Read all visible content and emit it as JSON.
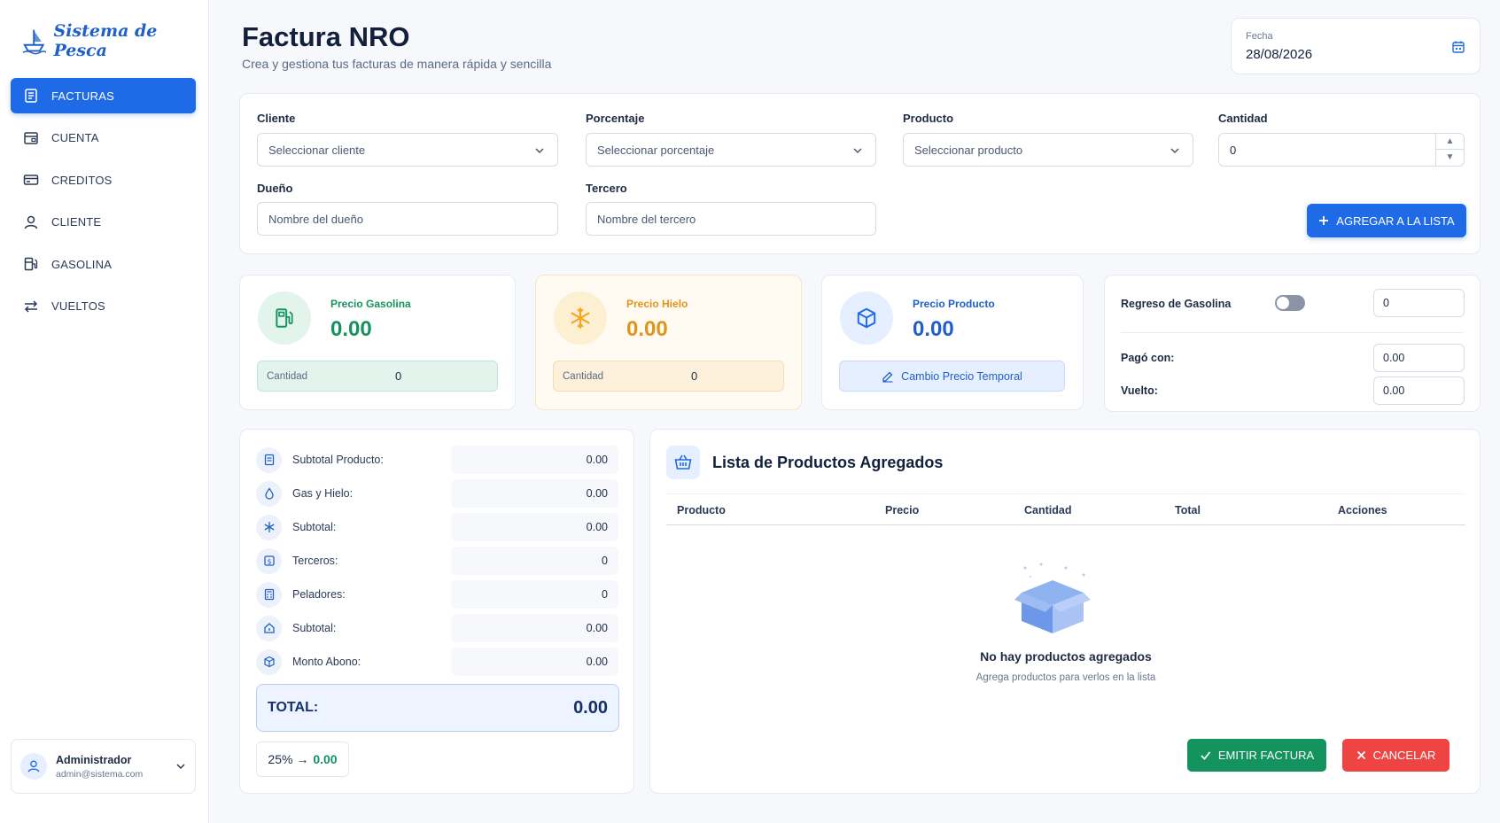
{
  "app": {
    "name": "Sistema de Pesca"
  },
  "sidebar": {
    "items": [
      {
        "label": "FACTURAS",
        "icon": "invoice-icon"
      },
      {
        "label": "CUENTA",
        "icon": "account-icon"
      },
      {
        "label": "CREDITOS",
        "icon": "credit-card-icon"
      },
      {
        "label": "CLIENTE",
        "icon": "user-icon"
      },
      {
        "label": "GASOLINA",
        "icon": "gas-station-icon"
      },
      {
        "label": "VUELTOS",
        "icon": "exchange-icon"
      }
    ],
    "active_index": 0
  },
  "user": {
    "name": "Administrador",
    "email": "admin@sistema.com"
  },
  "header": {
    "title": "Factura NRO",
    "subtitle": "Crea y gestiona tus facturas de manera rápida y sencilla",
    "date_label": "Fecha",
    "date_value": "28/08/2026"
  },
  "form": {
    "cliente": {
      "label": "Cliente",
      "placeholder": "Seleccionar cliente"
    },
    "porcentaje": {
      "label": "Porcentaje",
      "placeholder": "Seleccionar porcentaje"
    },
    "producto": {
      "label": "Producto",
      "placeholder": "Seleccionar producto"
    },
    "cantidad": {
      "label": "Cantidad",
      "value": "0"
    },
    "dueno": {
      "label": "Dueño",
      "placeholder": "Nombre del dueño"
    },
    "tercero": {
      "label": "Tercero",
      "placeholder": "Nombre del tercero"
    },
    "add_button": "AGREGAR A LA LISTA"
  },
  "prices": {
    "gasolina": {
      "label": "Precio Gasolina",
      "value": "0.00",
      "qty_label": "Cantidad",
      "qty_value": "0"
    },
    "hielo": {
      "label": "Precio Hielo",
      "value": "0.00",
      "qty_label": "Cantidad",
      "qty_value": "0"
    },
    "producto": {
      "label": "Precio Producto",
      "value": "0.00",
      "button": "Cambio Precio Temporal"
    }
  },
  "regreso": {
    "label": "Regreso de Gasolina",
    "toggle_on": false,
    "value": "0",
    "pago_label": "Pagó con:",
    "pago_value": "0.00",
    "vuelto_label": "Vuelto:",
    "vuelto_value": "0.00"
  },
  "summary": {
    "rows": [
      {
        "label": "Subtotal Producto:",
        "value": "0.00",
        "icon": "receipt-icon"
      },
      {
        "label": "Gas y Hielo:",
        "value": "0.00",
        "icon": "drop-icon"
      },
      {
        "label": "Subtotal:",
        "value": "0.00",
        "icon": "snowflake-icon"
      },
      {
        "label": "Terceros:",
        "value": "0",
        "icon": "dollar-icon"
      },
      {
        "label": "Peladores:",
        "value": "0",
        "icon": "calculator-icon"
      },
      {
        "label": "Subtotal:",
        "value": "0.00",
        "icon": "home-icon"
      },
      {
        "label": "Monto Abono:",
        "value": "0.00",
        "icon": "box-icon"
      }
    ],
    "total_label": "TOTAL:",
    "total_value": "0.00",
    "percent_label": "25% →",
    "percent_value": "0.00"
  },
  "list": {
    "title": "Lista de Productos Agregados",
    "columns": [
      "Producto",
      "Precio",
      "Cantidad",
      "Total",
      "Acciones"
    ],
    "empty_title": "No hay productos agregados",
    "empty_subtitle": "Agrega productos para verlos en la lista",
    "emit_button": "EMITIR FACTURA",
    "cancel_button": "CANCELAR"
  },
  "colors": {
    "primary": "#1f6ae6",
    "success": "#14935f",
    "danger": "#ef4444",
    "ice": "#f5a623",
    "background": "#f6f8fc"
  }
}
